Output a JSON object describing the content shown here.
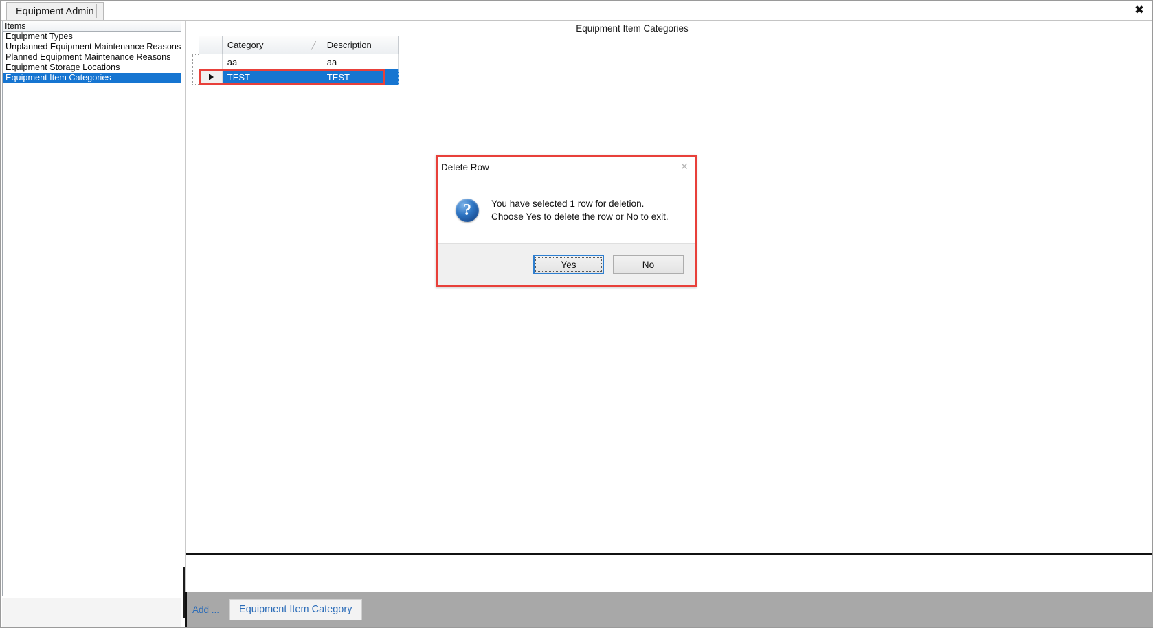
{
  "window": {
    "close_icon": "close-icon",
    "close_glyph": "✖"
  },
  "tabstrip": {
    "tabs": [
      {
        "label": "Equipment Admin",
        "active": true
      }
    ]
  },
  "sidebar": {
    "header": "Items",
    "items": [
      {
        "label": "Equipment Types",
        "selected": false
      },
      {
        "label": "Unplanned Equipment Maintenance Reasons",
        "selected": false
      },
      {
        "label": "Planned Equipment Maintenance Reasons",
        "selected": false
      },
      {
        "label": "Equipment Storage Locations",
        "selected": false
      },
      {
        "label": "Equipment Item Categories",
        "selected": true
      }
    ]
  },
  "content": {
    "title": "Equipment Item Categories",
    "grid": {
      "columns": [
        {
          "label": "Category",
          "sorted": "asc",
          "sort_glyph": "╱"
        },
        {
          "label": "Description",
          "sorted": "",
          "sort_glyph": ""
        }
      ],
      "rows": [
        {
          "category": "aa",
          "description": "aa",
          "selected": false,
          "current": false
        },
        {
          "category": "TEST",
          "description": "TEST",
          "selected": true,
          "current": true
        }
      ]
    }
  },
  "bottom_toolbar": {
    "add_label": "Add ...",
    "add_chip_label": "Equipment Item Category"
  },
  "dialog": {
    "title": "Delete Row",
    "close_glyph": "✕",
    "icon": "question-icon",
    "icon_glyph": "?",
    "message_line1": "You have selected 1 row for deletion.",
    "message_line2": "Choose Yes to delete the row or No to exit.",
    "buttons": [
      {
        "label": "Yes",
        "default": true
      },
      {
        "label": "No",
        "default": false
      }
    ]
  },
  "colors": {
    "selection_blue": "#1675d1",
    "highlight_red": "#e8403a",
    "link_blue": "#2b6cb8",
    "toolbar_gray": "#a8a8a8"
  }
}
